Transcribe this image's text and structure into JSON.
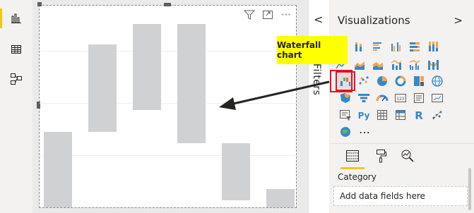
{
  "left_rail": {
    "items": [
      {
        "icon": "report-view-icon",
        "active": true
      },
      {
        "icon": "data-view-icon",
        "active": false
      },
      {
        "icon": "model-view-icon",
        "active": false
      }
    ]
  },
  "visual": {
    "toolbar_icons": [
      "filter-icon",
      "focus-mode-icon",
      "more-options-icon"
    ],
    "more_glyph": "⋯",
    "chart_data": {
      "type": "bar",
      "subtype": "waterfall",
      "categories": [
        "",
        "",
        "",
        "",
        "",
        ""
      ],
      "values": [
        0.41,
        0.48,
        0.47,
        0.65,
        0.31,
        0.1
      ],
      "value_units": "fraction of plot height (axes not shown)",
      "bar_color": "#d0d1d3",
      "grid": true,
      "legend": "none"
    }
  },
  "filters_pane": {
    "collapse_glyph": "<",
    "label": "Filters"
  },
  "visualizations_pane": {
    "title": "Visualizations",
    "expand_glyph": ">",
    "more_glyph": "…",
    "selected_icon": "waterfall-chart-icon",
    "tabs": [
      "fields-tab-icon",
      "format-tab-icon",
      "analytics-tab-icon"
    ],
    "category_label": "Category",
    "drop_placeholder": "Add data fields here"
  },
  "callout": {
    "text": "Waterfall chart",
    "color": "#ffff00"
  },
  "colors": {
    "accent": "#f2c811",
    "selection": "#e81123",
    "bar": "#d0d1d3"
  }
}
